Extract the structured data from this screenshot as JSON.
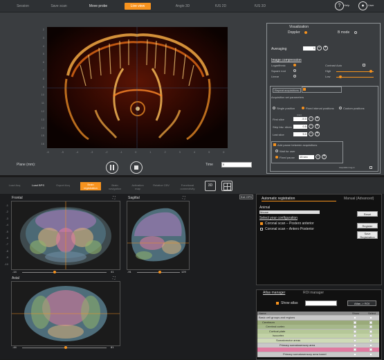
{
  "top": {
    "tabs": [
      "Session",
      "Save scan",
      "Move probe",
      "Live view",
      "Angio 3D",
      "fUS 2D",
      "fUS 3D"
    ],
    "active_tab": "Live view",
    "help_label": "Help",
    "user_label": "User",
    "plane_label": "Plane (mm):",
    "time_label": "Time",
    "time_value": "0",
    "y_ticks": [
      "2",
      "3",
      "4",
      "5",
      "6",
      "7",
      "8",
      "9",
      "10",
      "11",
      "12",
      "13",
      "14",
      "15",
      "16"
    ],
    "x_ticks": [
      "-6",
      "-5",
      "-4",
      "-3",
      "-2",
      "-1",
      "0",
      "1",
      "2",
      "3",
      "4",
      "5",
      "6"
    ],
    "panel": {
      "visualization_title": "Visualization",
      "doppler_label": "Doppler",
      "bmode_label": "B mode",
      "averaging_label": "Averaging",
      "averaging_value": "1",
      "image_compression_title": "Image compression",
      "logarithmic_label": "Logarithmic",
      "square_root_label": "Square root",
      "linear_label": "Linear",
      "contrast_label": "Contrast Auto",
      "high_label": "High",
      "low_label": "Low",
      "repeat_acq_tab": "Repeat acquisitions",
      "acq_params_title": "Acquisition set parameters",
      "single_position": "Single position",
      "fixed_interval": "Fixed interval positions",
      "custom_positions": "Custom positions",
      "unit_mm": "(mm)",
      "first_slice": "First slice",
      "first_slice_value": "-5.0",
      "step_label": "Step btw. slices",
      "step_value": "0.5",
      "last_slice": "Last slice",
      "last_slice_value": "5.0",
      "add_pause_label": "Add pause between acquisitions",
      "wait_user_label": "Wait for user",
      "fixed_pause_label": "Fixed pause",
      "fixed_pause_value": "15 sec",
      "acq_log_label": "Acquisition log-in"
    }
  },
  "bottom": {
    "tabs": [
      "Load Acq",
      "Load BPS",
      "Export Acq",
      "Brain registration",
      "Brain navigation",
      "Activation map",
      "Relative CBV",
      "Functional connectivity"
    ],
    "active_tab": "Brain registration",
    "btn_3d": "3D",
    "frontal_label": "Frontal",
    "sagittal_label": "Sagittal",
    "axial_label": "Axial",
    "exit_gps": "Exit GPS",
    "frontal_range": [
      "-14",
      "41"
    ],
    "sagittal_range": [
      "-91",
      "129"
    ],
    "axial_range": [
      "-44",
      "81"
    ],
    "y_ticks": [
      "-1",
      "-2",
      "-3",
      "-4",
      "-5",
      "-6",
      "-7",
      "-8",
      "-9",
      "-10"
    ],
    "reg_tab": "Automatic registration",
    "manual_tab": "Manual (Advanced)",
    "animal_label": "Animal",
    "animal_value": "Mouse",
    "config_label": "Select your configuration",
    "coronal_pa": "Coronal scan – Postero anterior",
    "coronal_ap": "Coronal scan – Antero Posterior",
    "reset_btn": "Reset",
    "register_btn": "Register",
    "save_reg_btn": "Save Registration",
    "atlas_manager_tab": "Atlas manager",
    "roi_manager_tab": "ROI manager",
    "show_atlas": "Show atlas",
    "atlas_roi_btn": "Atlas -> ROI",
    "tree_headers": [
      "Name",
      "Show",
      "Select"
    ],
    "tree_rows": [
      "Basic cell groups and regions",
      "Cerebrum",
      "Cerebral cortex",
      "Cortical plate",
      "Isocortex",
      "Somatomotor areas",
      "Primary somatosensory area",
      "",
      "Primary somatosensory area barrel"
    ]
  },
  "colors": {
    "accent": "#f7931e",
    "panel": "#3a3d40"
  }
}
